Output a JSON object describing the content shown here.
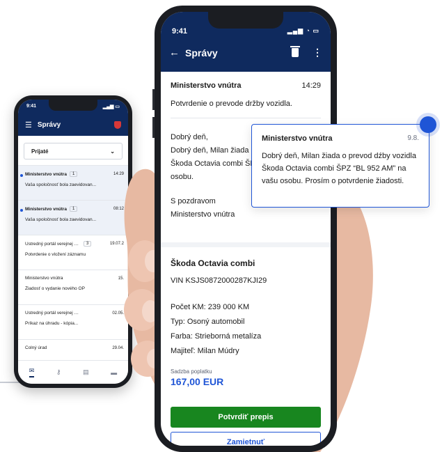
{
  "small_phone": {
    "status_time": "9:41",
    "title": "Správy",
    "filter_selected": "Prijaté",
    "messages": [
      {
        "sender": "Ministerstvo vnútra",
        "count": "1",
        "time": "14:29",
        "subject": "Vaša spoločnosť bola zaevidovan...",
        "unread": true
      },
      {
        "sender": "Ministerstvo vnútra",
        "count": "1",
        "time": "08:12",
        "subject": "Vaša spoločnosť bola zaevidovan...",
        "unread": true
      },
      {
        "sender": "Ústredný portál verejnej spr...",
        "count": "3",
        "time": "19.07.2",
        "subject": "Potvrdenie o vložení záznamu",
        "unread": false
      },
      {
        "sender": "Ministerstvo vnútra",
        "count": "",
        "time": "15.",
        "subject": "Žiadosť o vydanie nového OP",
        "unread": false
      },
      {
        "sender": "Ústredný portál verejnej správy",
        "count": "",
        "time": "02.05.",
        "subject": "Príkaz na úhradu - kópia...",
        "unread": false
      },
      {
        "sender": "Colný úrad",
        "count": "",
        "time": "29.04.",
        "subject": "",
        "unread": false
      }
    ],
    "tabs": [
      {
        "icon": "mail-icon",
        "glyph": "✉"
      },
      {
        "icon": "key-icon",
        "glyph": "⚷"
      },
      {
        "icon": "wallet-icon",
        "glyph": "▤"
      },
      {
        "icon": "folder-icon",
        "glyph": "▬"
      }
    ]
  },
  "large_phone": {
    "status_time": "9:41",
    "status_icons": "▂▄▆ ◔ ▭",
    "title": "Správy",
    "back_glyph": "←",
    "more_glyph": "⋮",
    "message": {
      "sender": "Ministerstvo vnútra",
      "time": "14:29",
      "subject": "Potvrdenie o prevode držby vozidla."
    },
    "body": {
      "line1": "Dobrý deň,",
      "line2": "Dobrý deň, Milan žiada o",
      "line3": "Škoda Octavia combi ŠPZ",
      "line4": "osobu.",
      "closing1": "S pozdravom",
      "closing2": "Ministerstvo vnútra"
    },
    "car": {
      "name": "Škoda Octavia combi",
      "vin": "VIN KSJS0872000287KJI29",
      "km": "Počet KM: 239 000 KM",
      "type": "Typ: Osoný automobil",
      "color": "Farba: Strieborná metalíza",
      "owner": "Majiteľ: Milan Múdry"
    },
    "fee_label": "Sadzba poplatku",
    "fee_value": "167,00 EUR",
    "confirm_label": "Potvrdiť prepis",
    "reject_label": "Zamietnuť"
  },
  "notification": {
    "sender": "Ministerstvo vnútra",
    "date": "9.8.",
    "text": "Dobrý deň, Milan žiada o prevod dźby vozidla Škoda Octavia combi ŠPZ “BL 952 AM” na vašu osobu. Prosím o potvrdenie žiadosti."
  },
  "colors": {
    "header": "#0f2a5e",
    "accent": "#1f55d6",
    "confirm": "#18861f",
    "alert": "#d73838"
  }
}
